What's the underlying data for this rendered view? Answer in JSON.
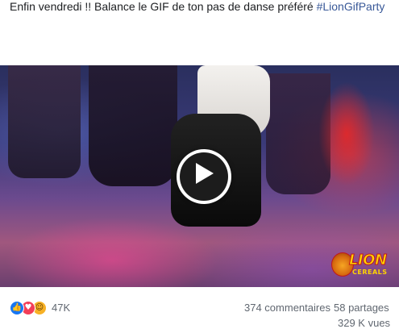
{
  "post": {
    "text": "Enfin vendredi !! Balance le GIF de ton pas de danse préféré ",
    "hashtag": "#LionGifParty"
  },
  "video": {
    "play_icon": "play-icon",
    "logo": {
      "word": "LION",
      "sub": "CEREALS",
      "icon": "lion-head-icon"
    }
  },
  "footer": {
    "reactions": {
      "icons": [
        "like-icon",
        "love-icon",
        "haha-icon"
      ],
      "count": "47K"
    },
    "comments": "374 commentaires",
    "shares": "58 partages",
    "views": "329 K vues"
  },
  "colors": {
    "link": "#385898",
    "meta": "#606770",
    "like": "#1877f2",
    "love": "#f33e58",
    "haha": "#f7b125"
  }
}
